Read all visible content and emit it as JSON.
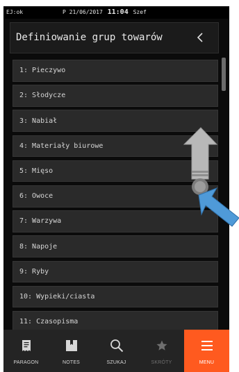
{
  "status_bar": {
    "left": "EJ:ok",
    "date_prefix": "P 21/06/2017",
    "time": "11:04",
    "user": "Szef"
  },
  "header": {
    "title": "Definiowanie grup towarów",
    "back_icon": "chevron-left-icon"
  },
  "list": {
    "items": [
      "1: Pieczywo",
      "2: Słodycze",
      "3: Nabiał",
      "4: Materiały biurowe",
      "5: Mięso",
      "6: Owoce",
      "7: Warzywa",
      "8: Napoje",
      "9: Ryby",
      "10: Wypieki/ciasta",
      "11: Czasopisma"
    ]
  },
  "bottom_nav": {
    "tabs": [
      {
        "label": "PARAGON",
        "icon": "receipt-icon",
        "state": "normal"
      },
      {
        "label": "NOTES",
        "icon": "notes-icon",
        "state": "normal"
      },
      {
        "label": "SZUKAJ",
        "icon": "search-icon",
        "state": "normal"
      },
      {
        "label": "SKRÓTY",
        "icon": "star-icon",
        "state": "disabled"
      },
      {
        "label": "MENU",
        "icon": "menu-icon",
        "state": "active"
      }
    ]
  },
  "colors": {
    "accent": "#ff5a1f",
    "background": "#0b0b0b",
    "list_item": "#2a2a2a",
    "overlay_arrow_up": "#b5b5b5",
    "overlay_arrow_pointer": "#4f9ad8"
  }
}
